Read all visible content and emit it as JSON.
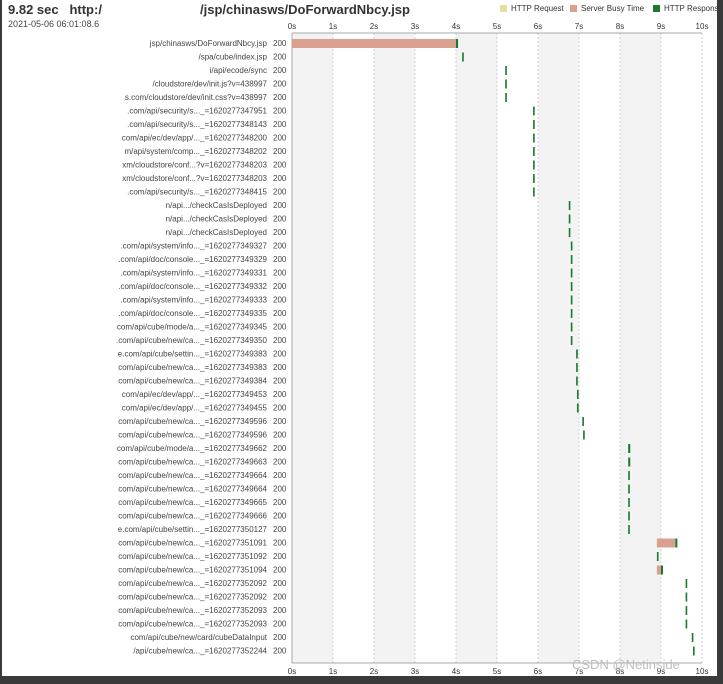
{
  "header": {
    "load_time": "9.82 sec",
    "url_prefix": "http:/",
    "url_path": "/jsp/chinasws/DoForwardNbcy.jsp",
    "timestamp": "2021-05-06 06:01:08.6"
  },
  "legend": [
    {
      "label": "HTTP Request",
      "color": "#e0e0a0"
    },
    {
      "label": "Server Busy Time",
      "color": "#d9a090"
    },
    {
      "label": "HTTP Response",
      "color": "#1a7a30"
    }
  ],
  "watermark": "CSDN @Netinside",
  "chart_data": {
    "type": "waterfall",
    "x_unit": "s",
    "x_ticks": [
      "0s",
      "1s",
      "2s",
      "3s",
      "4s",
      "5s",
      "6s",
      "7s",
      "8s",
      "9s",
      "10s"
    ],
    "xlim": [
      0,
      10
    ],
    "grid": true,
    "colors": {
      "server_busy": "#d9a090",
      "response": "#1a7a30",
      "request": "#e0e0a0",
      "grid": "#cfcfcf",
      "band": "#f3f3f3"
    },
    "rows": [
      {
        "url": "jsp/chinasws/DoForwardNbcy.jsp",
        "status": "200",
        "start": 0.0,
        "busy": 4.0,
        "response": 0.05
      },
      {
        "url": "/spa/cube/index.jsp",
        "status": "200",
        "start": 4.15,
        "busy": 0,
        "response": 0.04
      },
      {
        "url": "i/api/ecode/sync",
        "status": "200",
        "start": 5.2,
        "busy": 0,
        "response": 0.04
      },
      {
        "url": "/cloudstore/dev/init.js?v=438997",
        "status": "200",
        "start": 5.2,
        "busy": 0,
        "response": 0.04
      },
      {
        "url": "s.com/cloudstore/dev/init.css?v=438997",
        "status": "200",
        "start": 5.2,
        "busy": 0,
        "response": 0.04
      },
      {
        "url": ".com/api/security/s..._=1620277347951",
        "status": "200",
        "start": 5.88,
        "busy": 0,
        "response": 0.04
      },
      {
        "url": ".com/api/security/s..._=1620277348143",
        "status": "200",
        "start": 5.88,
        "busy": 0,
        "response": 0.04
      },
      {
        "url": "com/api/ec/dev/app/..._=1620277348200",
        "status": "200",
        "start": 5.88,
        "busy": 0,
        "response": 0.04
      },
      {
        "url": "m/api/system/comp..._=1620277348202",
        "status": "200",
        "start": 5.88,
        "busy": 0,
        "response": 0.04
      },
      {
        "url": "xm/cloudstore/conf...?v=1620277348203",
        "status": "200",
        "start": 5.88,
        "busy": 0,
        "response": 0.04
      },
      {
        "url": "xm/cloudstore/conf...?v=1620277348203",
        "status": "200",
        "start": 5.88,
        "busy": 0,
        "response": 0.04
      },
      {
        "url": ".com/api/security/s..._=1620277348415",
        "status": "200",
        "start": 5.88,
        "busy": 0,
        "response": 0.04
      },
      {
        "url": "n/api.../checkCasIsDeployed",
        "status": "200",
        "start": 6.75,
        "busy": 0,
        "response": 0.04
      },
      {
        "url": "n/api.../checkCasIsDeployed",
        "status": "200",
        "start": 6.75,
        "busy": 0,
        "response": 0.04
      },
      {
        "url": "n/api.../checkCasIsDeployed",
        "status": "200",
        "start": 6.75,
        "busy": 0,
        "response": 0.04
      },
      {
        "url": ".com/api/system/info..._=1620277349327",
        "status": "200",
        "start": 6.8,
        "busy": 0,
        "response": 0.04
      },
      {
        "url": ".com/api/doc/console..._=1620277349329",
        "status": "200",
        "start": 6.8,
        "busy": 0,
        "response": 0.04
      },
      {
        "url": ".com/api/system/info..._=1620277349331",
        "status": "200",
        "start": 6.8,
        "busy": 0,
        "response": 0.04
      },
      {
        "url": ".com/api/doc/console..._=1620277349332",
        "status": "200",
        "start": 6.8,
        "busy": 0,
        "response": 0.04
      },
      {
        "url": ".com/api/system/info..._=1620277349333",
        "status": "200",
        "start": 6.8,
        "busy": 0,
        "response": 0.04
      },
      {
        "url": ".com/api/doc/console..._=1620277349335",
        "status": "200",
        "start": 6.8,
        "busy": 0,
        "response": 0.04
      },
      {
        "url": "com/api/cube/mode/a..._=1620277349345",
        "status": "200",
        "start": 6.8,
        "busy": 0,
        "response": 0.04
      },
      {
        "url": ".com/api/cube/new/ca..._=1620277349350",
        "status": "200",
        "start": 6.8,
        "busy": 0,
        "response": 0.04
      },
      {
        "url": "e.com/api/cube/settin..._=1620277349383",
        "status": "200",
        "start": 6.93,
        "busy": 0,
        "response": 0.04
      },
      {
        "url": "com/api/cube/new/ca..._=1620277349383",
        "status": "200",
        "start": 6.93,
        "busy": 0,
        "response": 0.04
      },
      {
        "url": "com/api/cube/new/ca..._=1620277349384",
        "status": "200",
        "start": 6.93,
        "busy": 0,
        "response": 0.04
      },
      {
        "url": "com/api/ec/dev/app/..._=1620277349453",
        "status": "200",
        "start": 6.95,
        "busy": 0,
        "response": 0.04
      },
      {
        "url": "com/api/ec/dev/app/..._=1620277349455",
        "status": "200",
        "start": 6.95,
        "busy": 0,
        "response": 0.04
      },
      {
        "url": "com/api/cube/new/ca..._=1620277349596",
        "status": "200",
        "start": 7.08,
        "busy": 0,
        "response": 0.04
      },
      {
        "url": "com/api/cube/new/ca..._=1620277349596",
        "status": "200",
        "start": 7.1,
        "busy": 0,
        "response": 0.04
      },
      {
        "url": "com/api/cube/mode/a..._=1620277349662",
        "status": "200",
        "start": 8.2,
        "busy": 0,
        "response": 0.05
      },
      {
        "url": "com/api/cube/new/ca..._=1620277349663",
        "status": "200",
        "start": 8.2,
        "busy": 0,
        "response": 0.05
      },
      {
        "url": "com/api/cube/new/ca..._=1620277349664",
        "status": "200",
        "start": 8.2,
        "busy": 0,
        "response": 0.04
      },
      {
        "url": "com/api/cube/new/ca..._=1620277349664",
        "status": "200",
        "start": 8.2,
        "busy": 0,
        "response": 0.04
      },
      {
        "url": "com/api/cube/new/ca..._=1620277349665",
        "status": "200",
        "start": 8.2,
        "busy": 0,
        "response": 0.04
      },
      {
        "url": "com/api/cube/new/ca..._=1620277349666",
        "status": "200",
        "start": 8.2,
        "busy": 0,
        "response": 0.04
      },
      {
        "url": "e.com/api/cube/settin..._=1620277350127",
        "status": "200",
        "start": 8.2,
        "busy": 0,
        "response": 0.04
      },
      {
        "url": "com/api/cube/new/ca..._=1620277351091",
        "status": "200",
        "start": 8.9,
        "busy": 0.45,
        "response": 0.05
      },
      {
        "url": "com/api/cube/new/ca..._=1620277351092",
        "status": "200",
        "start": 8.9,
        "busy": 0,
        "response": 0.04
      },
      {
        "url": "com/api/cube/new/ca..._=1620277351094",
        "status": "200",
        "start": 8.9,
        "busy": 0.1,
        "response": 0.05
      },
      {
        "url": "com/api/cube/new/ca..._=1620277352092",
        "status": "200",
        "start": 9.6,
        "busy": 0,
        "response": 0.04
      },
      {
        "url": "com/api/cube/new/ca..._=1620277352092",
        "status": "200",
        "start": 9.6,
        "busy": 0,
        "response": 0.04
      },
      {
        "url": "com/api/cube/new/ca..._=1620277352093",
        "status": "200",
        "start": 9.6,
        "busy": 0,
        "response": 0.04
      },
      {
        "url": "com/api/cube/new/ca..._=1620277352093",
        "status": "200",
        "start": 9.6,
        "busy": 0,
        "response": 0.04
      },
      {
        "url": "com/api/cube/new/card/cubeDataInput",
        "status": "200",
        "start": 9.75,
        "busy": 0,
        "response": 0.04
      },
      {
        "url": "/api/cube/new/ca..._=1620277352244",
        "status": "200",
        "start": 9.78,
        "busy": 0,
        "response": 0.04
      }
    ]
  }
}
